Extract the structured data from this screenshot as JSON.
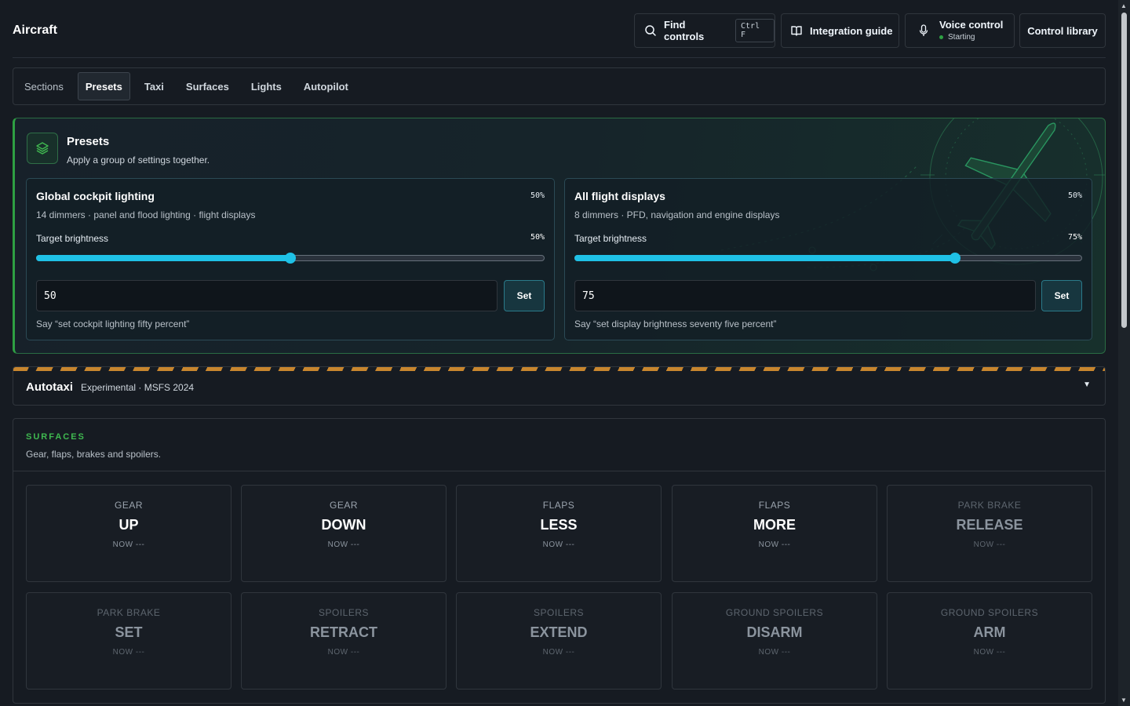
{
  "header": {
    "title": "Aircraft",
    "find_label": "Find controls",
    "find_shortcut": "Ctrl F",
    "guide_label": "Integration guide",
    "voice_label": "Voice control",
    "voice_status": "Starting",
    "library_label": "Control library"
  },
  "tabs": [
    "Sections",
    "Presets",
    "Taxi",
    "Surfaces",
    "Lights",
    "Autopilot"
  ],
  "active_tab": "Presets",
  "presets": {
    "title": "Presets",
    "subtitle": "Apply a group of settings together.",
    "cards": [
      {
        "title": "Global cockpit lighting",
        "current_pct": "50%",
        "subtitle": "14 dimmers · panel and flood lighting · flight displays",
        "target_label": "Target brightness",
        "target_pct": "50%",
        "slider_value": 0.5,
        "input_value": "50",
        "set_label": "Set",
        "hint": "Say “set cockpit lighting fifty percent”"
      },
      {
        "title": "All flight displays",
        "current_pct": "50%",
        "subtitle": "8 dimmers · PFD, navigation and engine displays",
        "target_label": "Target brightness",
        "target_pct": "75%",
        "slider_value": 0.75,
        "input_value": "75",
        "set_label": "Set",
        "hint": "Say “set display brightness seventy five percent”"
      }
    ]
  },
  "autotaxi": {
    "title": "Autotaxi",
    "subtitle": "Experimental · MSFS 2024",
    "caret": "▼"
  },
  "surfaces": {
    "label": "SURFACES",
    "subtitle": "Gear, flaps, brakes and spoilers.",
    "controls": [
      {
        "category": "GEAR",
        "action": "UP",
        "now": "NOW ---",
        "enabled": true
      },
      {
        "category": "GEAR",
        "action": "DOWN",
        "now": "NOW ---",
        "enabled": true
      },
      {
        "category": "FLAPS",
        "action": "LESS",
        "now": "NOW ---",
        "enabled": true
      },
      {
        "category": "FLAPS",
        "action": "MORE",
        "now": "NOW ---",
        "enabled": true
      },
      {
        "category": "PARK BRAKE",
        "action": "RELEASE",
        "now": "NOW ---",
        "enabled": false
      },
      {
        "category": "PARK BRAKE",
        "action": "SET",
        "now": "NOW ---",
        "enabled": false
      },
      {
        "category": "SPOILERS",
        "action": "RETRACT",
        "now": "NOW ---",
        "enabled": false
      },
      {
        "category": "SPOILERS",
        "action": "EXTEND",
        "now": "NOW ---",
        "enabled": false
      },
      {
        "category": "GROUND SPOILERS",
        "action": "DISARM",
        "now": "NOW ---",
        "enabled": false
      },
      {
        "category": "GROUND SPOILERS",
        "action": "ARM",
        "now": "NOW ---",
        "enabled": false
      }
    ]
  },
  "colors": {
    "accent_cyan": "#1fc1e6",
    "accent_green": "#2ea043",
    "hazard_orange": "#c8862e",
    "background": "#161b22"
  }
}
